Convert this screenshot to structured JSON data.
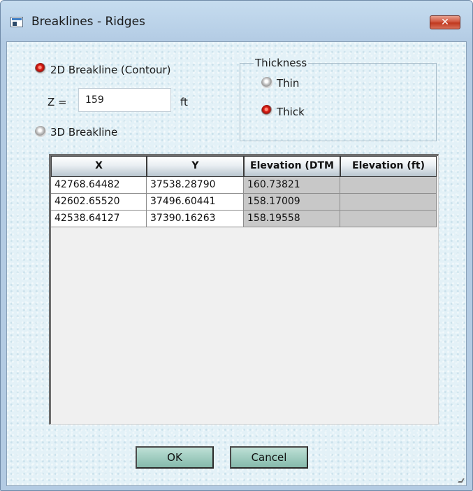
{
  "window": {
    "title": "Breaklines - Ridges",
    "close_label": "✕"
  },
  "breakline_type": {
    "option_2d": {
      "label": "2D Breakline (Contour)",
      "selected": true
    },
    "option_3d": {
      "label": "3D Breakline",
      "selected": false
    },
    "z_label": "Z =",
    "z_value": "159",
    "z_unit": "ft"
  },
  "thickness": {
    "legend": "Thickness",
    "thin": {
      "label": "Thin",
      "selected": false
    },
    "thick": {
      "label": "Thick",
      "selected": true
    }
  },
  "table": {
    "columns": [
      "X",
      "Y",
      "Elevation (DTM",
      "Elevation (ft)"
    ],
    "rows": [
      [
        "42768.64482",
        "37538.28790",
        "160.73821",
        ""
      ],
      [
        "42602.65520",
        "37496.60441",
        "158.17009",
        ""
      ],
      [
        "42538.64127",
        "37390.16263",
        "158.19558",
        ""
      ]
    ]
  },
  "buttons": {
    "ok": "OK",
    "cancel": "Cancel"
  },
  "colors": {
    "radio_selected": "#e0251a",
    "dialog_bg": "#e3f1f7",
    "readonly_cell": "#c8c8c8"
  },
  "icons": [
    "app-icon",
    "close-icon",
    "resize-grip-icon"
  ]
}
